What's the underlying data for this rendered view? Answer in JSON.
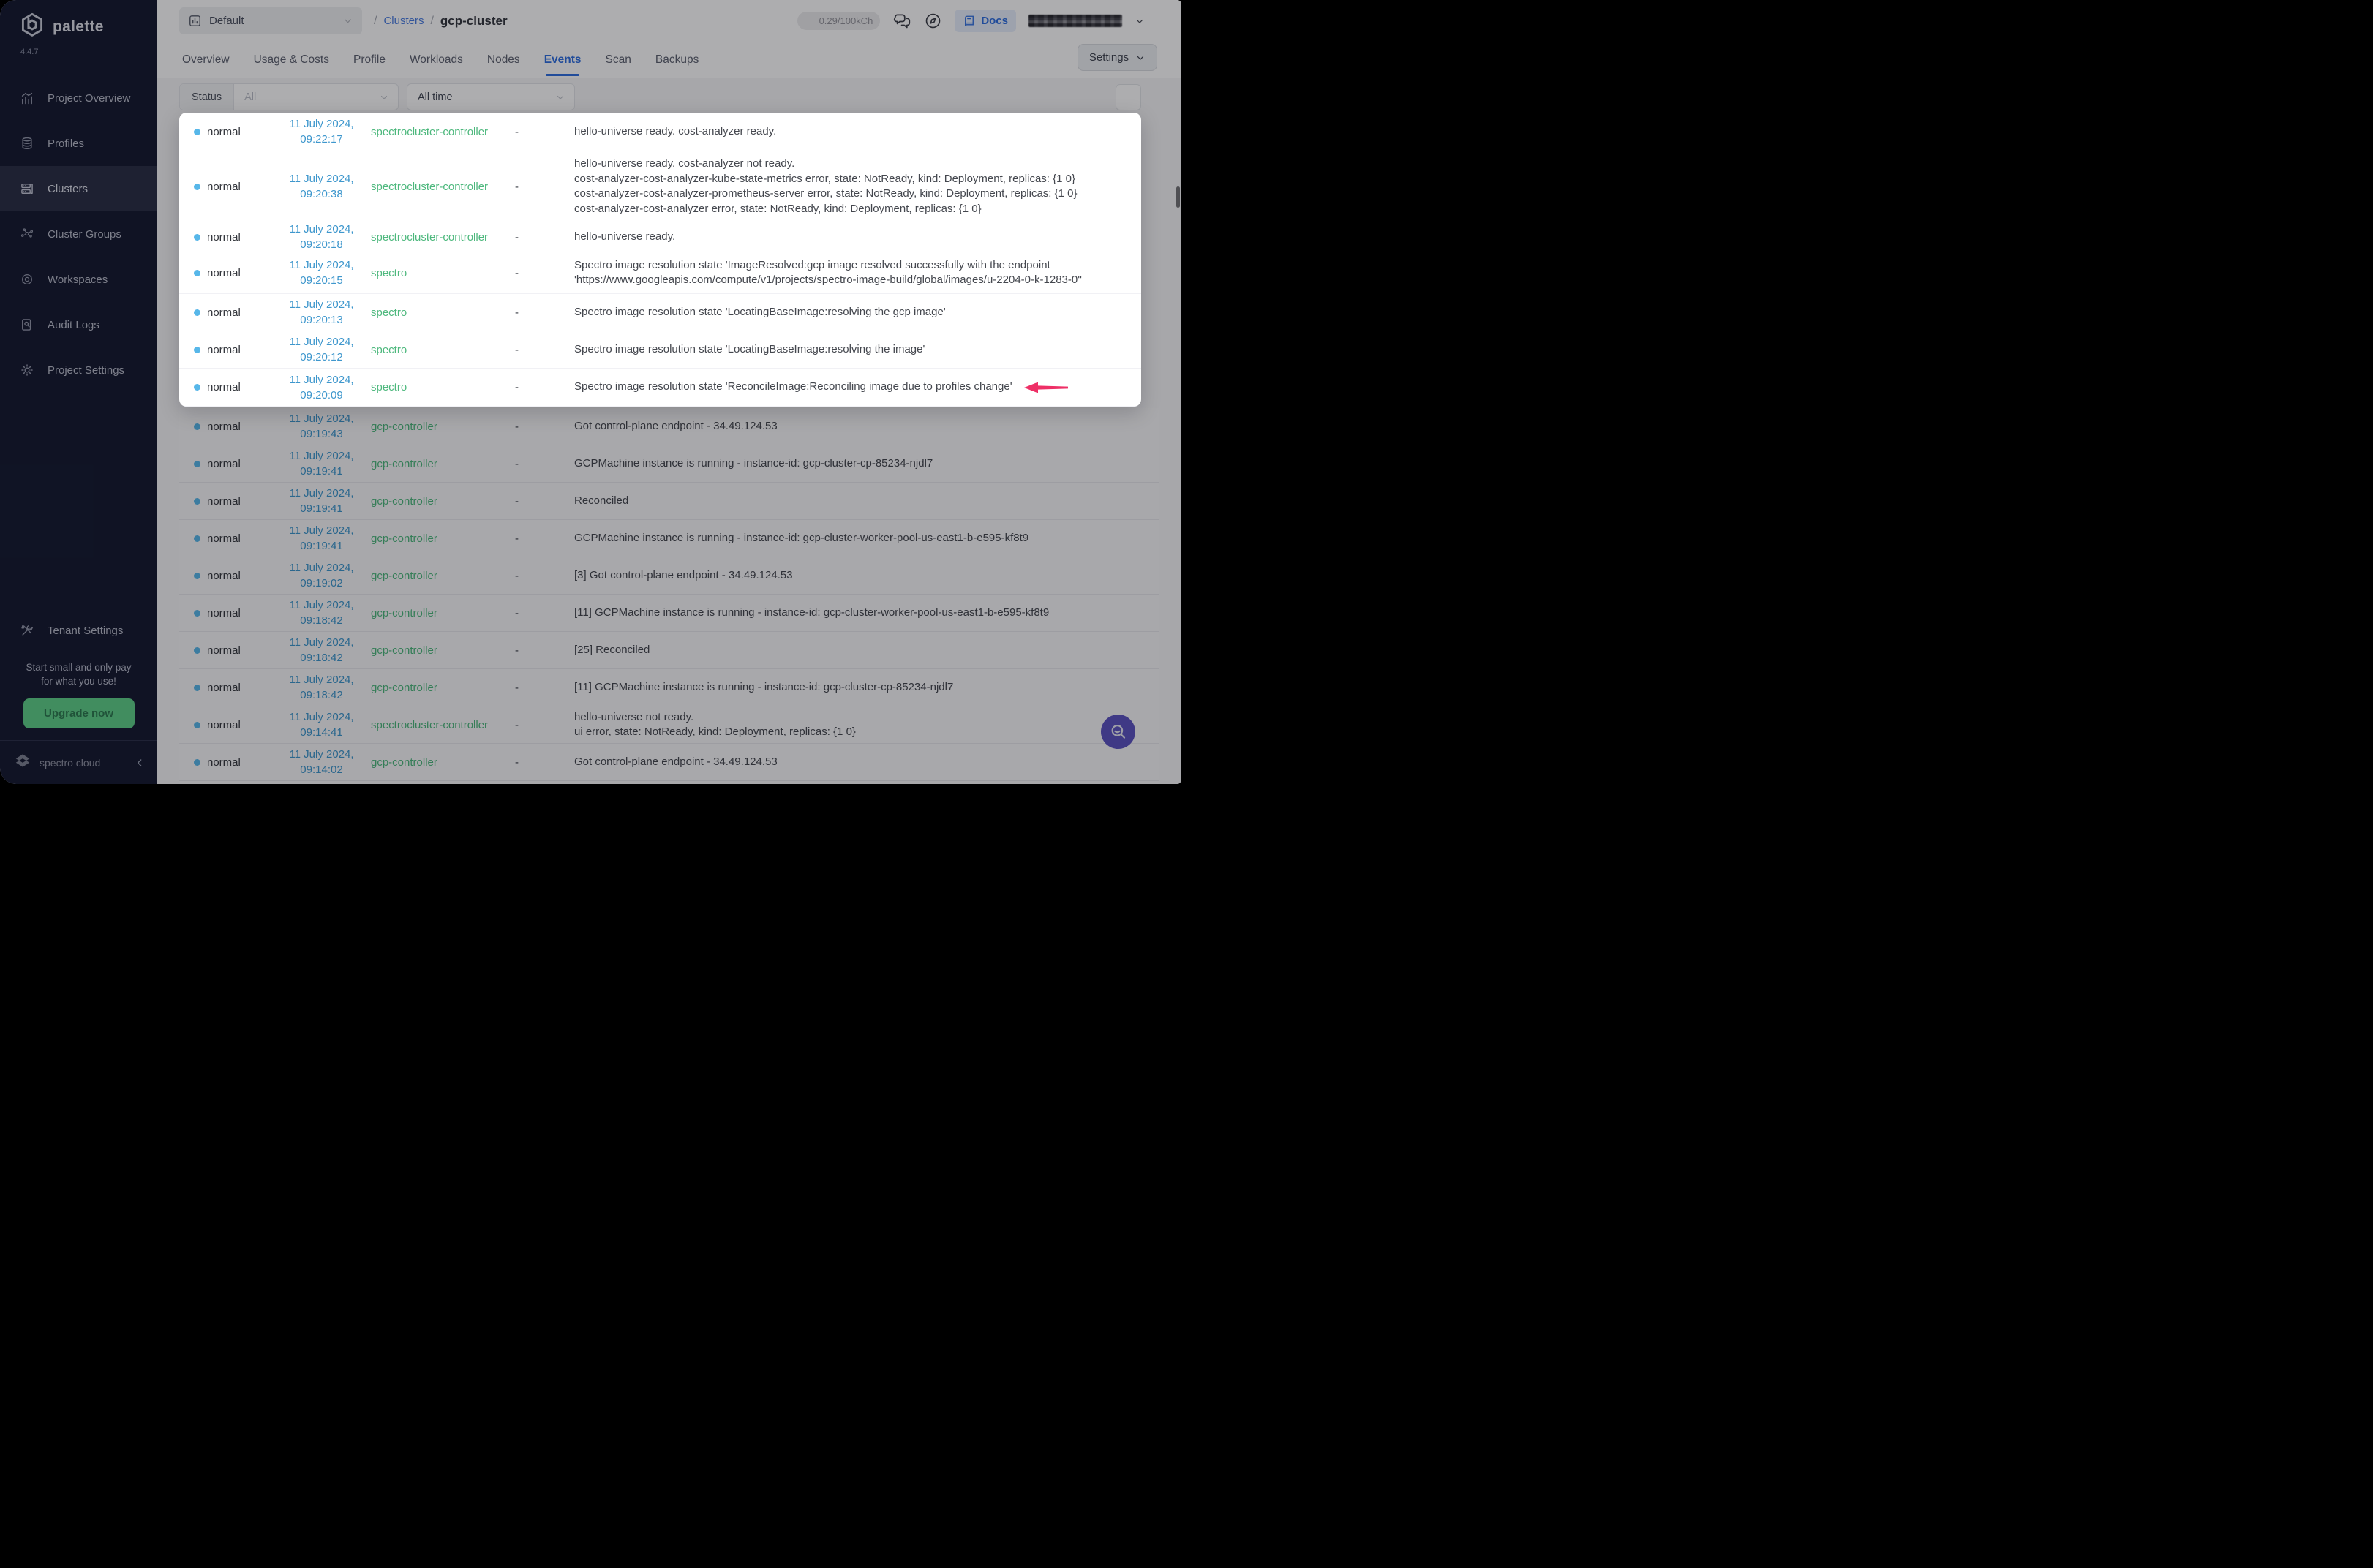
{
  "brand": {
    "name": "palette",
    "version": "4.4.7",
    "footer": "spectro cloud"
  },
  "sidebar": {
    "items": [
      {
        "label": "Project Overview",
        "icon": "chart-icon",
        "active": false
      },
      {
        "label": "Profiles",
        "icon": "layers-icon",
        "active": false
      },
      {
        "label": "Clusters",
        "icon": "server-icon",
        "active": true
      },
      {
        "label": "Cluster Groups",
        "icon": "nodes-icon",
        "active": false
      },
      {
        "label": "Workspaces",
        "icon": "orbit-icon",
        "active": false
      },
      {
        "label": "Audit Logs",
        "icon": "audit-icon",
        "active": false
      },
      {
        "label": "Project Settings",
        "icon": "gear-icon",
        "active": false
      }
    ],
    "tenant_settings": {
      "label": "Tenant Settings",
      "icon": "tools-icon"
    },
    "promo": {
      "text_line1": "Start small and only pay",
      "text_line2": "for what you use!",
      "cta": "Upgrade now"
    }
  },
  "header": {
    "project_selector": {
      "value": "Default"
    },
    "breadcrumb": {
      "separator": "/",
      "section": "Clusters",
      "current": "gcp-cluster"
    },
    "usage_badge": "0.29/100kCh",
    "docs_label": "Docs"
  },
  "tabs": {
    "items": [
      "Overview",
      "Usage & Costs",
      "Profile",
      "Workloads",
      "Nodes",
      "Events",
      "Scan",
      "Backups"
    ],
    "active": "Events"
  },
  "settings_button": {
    "label": "Settings"
  },
  "filters": {
    "status_label": "Status",
    "status_value": "All",
    "time_range_value": "All time"
  },
  "events": {
    "rows": [
      {
        "status": "normal",
        "date": "11 July 2024,",
        "time": "09:22:17",
        "source": "spectrocluster-controller",
        "involved_object": "-",
        "highlight": true,
        "message": [
          "hello-universe ready. cost-analyzer ready."
        ]
      },
      {
        "status": "normal",
        "date": "11 July 2024,",
        "time": "09:20:38",
        "source": "spectrocluster-controller",
        "involved_object": "-",
        "highlight": true,
        "message": [
          "hello-universe ready. cost-analyzer not ready.",
          "cost-analyzer-cost-analyzer-kube-state-metrics error, state: NotReady, kind: Deployment, replicas: {1 0}",
          "cost-analyzer-cost-analyzer-prometheus-server error, state: NotReady, kind: Deployment, replicas: {1 0}",
          "cost-analyzer-cost-analyzer error, state: NotReady, kind: Deployment, replicas: {1 0}"
        ]
      },
      {
        "status": "normal",
        "date": "11 July 2024,",
        "time": "09:20:18",
        "source": "spectrocluster-controller",
        "involved_object": "-",
        "highlight": true,
        "message": [
          "hello-universe ready."
        ]
      },
      {
        "status": "normal",
        "date": "11 July 2024,",
        "time": "09:20:15",
        "source": "spectro",
        "involved_object": "-",
        "highlight": true,
        "message": [
          "Spectro image resolution state 'ImageResolved:gcp image resolved successfully with the endpoint 'https://www.googleapis.com/compute/v1/projects/spectro-image-build/global/images/u-2204-0-k-1283-0''"
        ]
      },
      {
        "status": "normal",
        "date": "11 July 2024,",
        "time": "09:20:13",
        "source": "spectro",
        "involved_object": "-",
        "highlight": true,
        "message": [
          "Spectro image resolution state 'LocatingBaseImage:resolving the gcp image'"
        ]
      },
      {
        "status": "normal",
        "date": "11 July 2024,",
        "time": "09:20:12",
        "source": "spectro",
        "involved_object": "-",
        "highlight": true,
        "message": [
          "Spectro image resolution state 'LocatingBaseImage:resolving the image'"
        ]
      },
      {
        "status": "normal",
        "date": "11 July 2024,",
        "time": "09:20:09",
        "source": "spectro",
        "involved_object": "-",
        "highlight": true,
        "annotated": true,
        "message": [
          "Spectro image resolution state 'ReconcileImage:Reconciling image due to profiles change'"
        ]
      },
      {
        "status": "normal",
        "date": "11 July 2024,",
        "time": "09:19:43",
        "source": "gcp-controller",
        "involved_object": "-",
        "highlight": false,
        "message": [
          "Got control-plane endpoint - 34.49.124.53"
        ]
      },
      {
        "status": "normal",
        "date": "11 July 2024,",
        "time": "09:19:41",
        "source": "gcp-controller",
        "involved_object": "-",
        "highlight": false,
        "message": [
          "GCPMachine instance is running - instance-id: gcp-cluster-cp-85234-njdl7"
        ]
      },
      {
        "status": "normal",
        "date": "11 July 2024,",
        "time": "09:19:41",
        "source": "gcp-controller",
        "involved_object": "-",
        "highlight": false,
        "message": [
          "Reconciled"
        ]
      },
      {
        "status": "normal",
        "date": "11 July 2024,",
        "time": "09:19:41",
        "source": "gcp-controller",
        "involved_object": "-",
        "highlight": false,
        "message": [
          "GCPMachine instance is running - instance-id: gcp-cluster-worker-pool-us-east1-b-e595-kf8t9"
        ]
      },
      {
        "status": "normal",
        "date": "11 July 2024,",
        "time": "09:19:02",
        "source": "gcp-controller",
        "involved_object": "-",
        "highlight": false,
        "message": [
          "[3] Got control-plane endpoint - 34.49.124.53"
        ]
      },
      {
        "status": "normal",
        "date": "11 July 2024,",
        "time": "09:18:42",
        "source": "gcp-controller",
        "involved_object": "-",
        "highlight": false,
        "message": [
          "[11] GCPMachine instance is running - instance-id: gcp-cluster-worker-pool-us-east1-b-e595-kf8t9"
        ]
      },
      {
        "status": "normal",
        "date": "11 July 2024,",
        "time": "09:18:42",
        "source": "gcp-controller",
        "involved_object": "-",
        "highlight": false,
        "message": [
          "[25] Reconciled"
        ]
      },
      {
        "status": "normal",
        "date": "11 July 2024,",
        "time": "09:18:42",
        "source": "gcp-controller",
        "involved_object": "-",
        "highlight": false,
        "message": [
          "[11] GCPMachine instance is running - instance-id: gcp-cluster-cp-85234-njdl7"
        ]
      },
      {
        "status": "normal",
        "date": "11 July 2024,",
        "time": "09:14:41",
        "source": "spectrocluster-controller",
        "involved_object": "-",
        "highlight": false,
        "message": [
          "hello-universe not ready.",
          "ui error, state: NotReady, kind: Deployment, replicas: {1 0}"
        ]
      },
      {
        "status": "normal",
        "date": "11 July 2024,",
        "time": "09:14:02",
        "source": "gcp-controller",
        "involved_object": "-",
        "highlight": false,
        "message": [
          "Got control-plane endpoint - 34.49.124.53"
        ]
      },
      {
        "status": "",
        "date": "",
        "time": "",
        "source": "",
        "involved_object": "",
        "highlight": false,
        "message": [
          ""
        ]
      }
    ]
  },
  "colors": {
    "accent": "#2f6fe0",
    "link_blue": "#4a7de0",
    "date_blue": "#3e97cd",
    "source_green": "#4db87d",
    "status_dot": "#57b7e9",
    "arrow_pink": "#ee2f66",
    "fab_purple": "#5b53c0",
    "upgrade_green": "#5fcf88",
    "sidebar_bg": "#151a31",
    "sidebar_active": "#2a2f45"
  }
}
